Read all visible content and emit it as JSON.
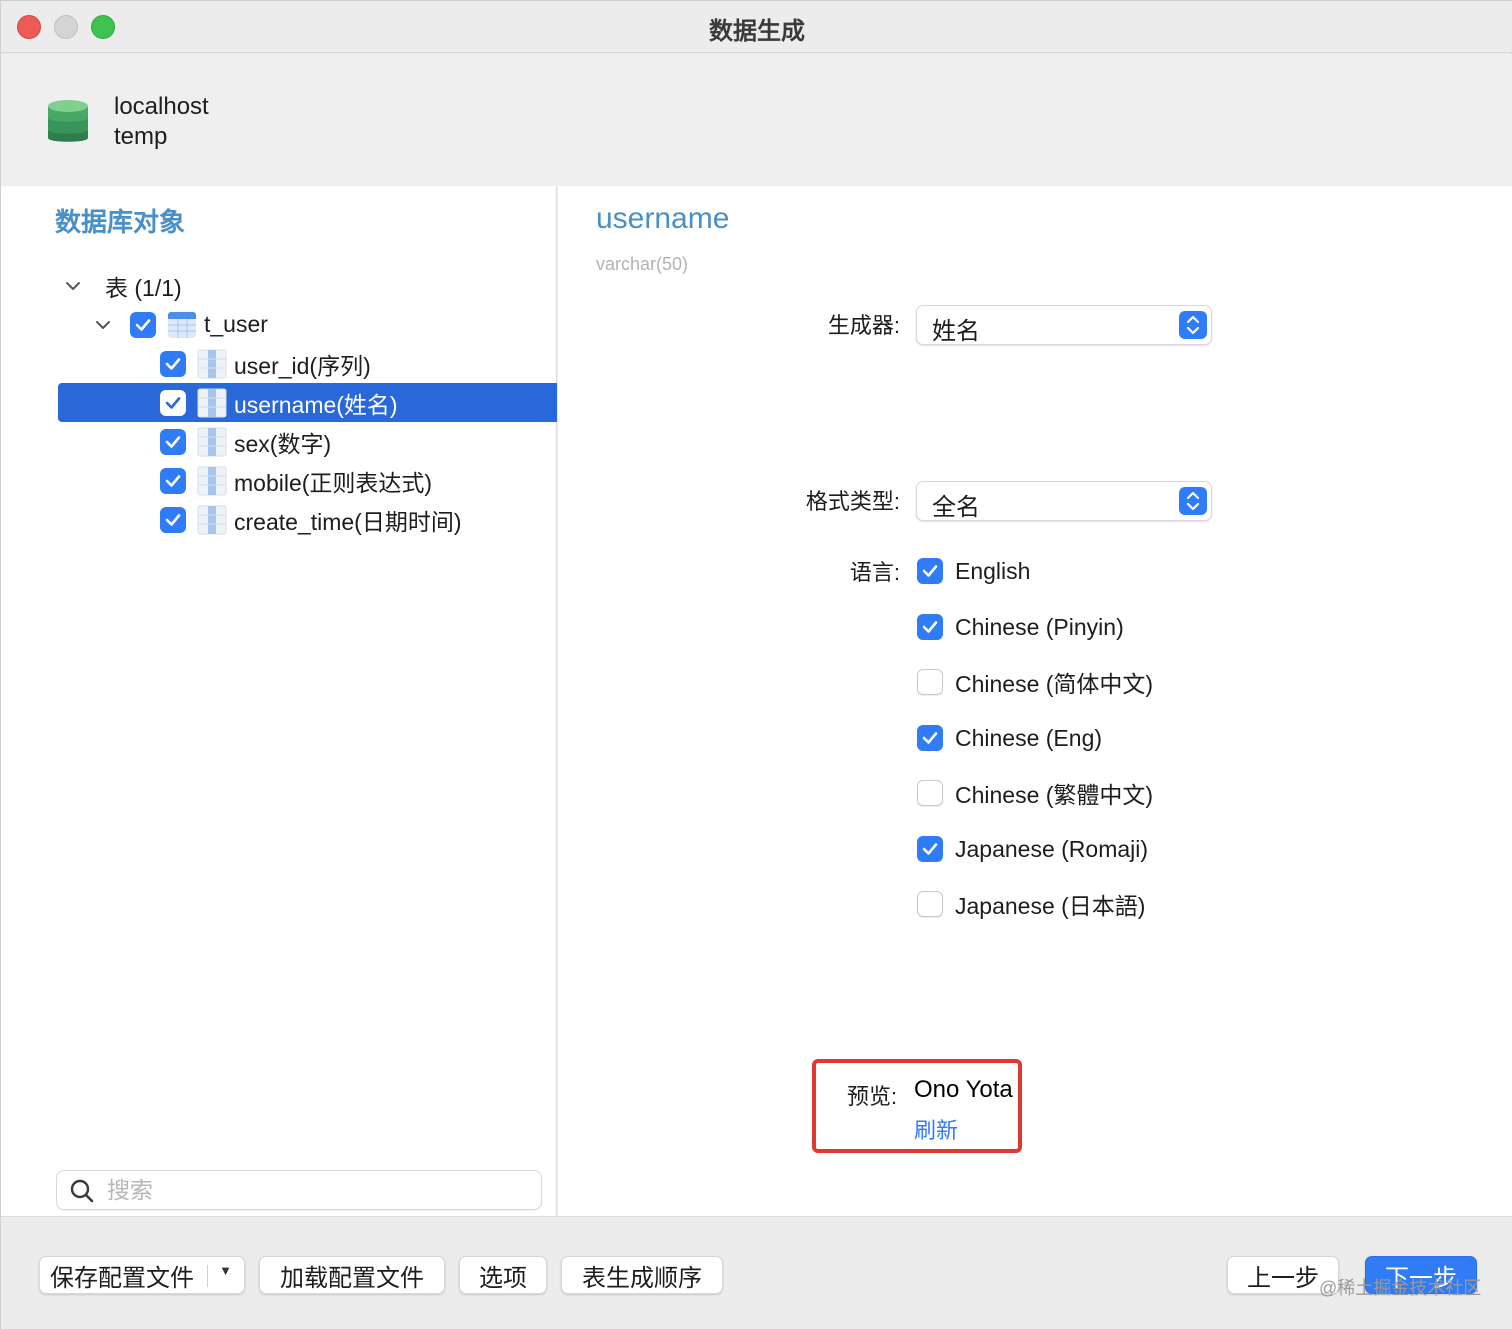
{
  "window": {
    "title": "数据生成"
  },
  "connection": {
    "name": "localhost",
    "database": "temp"
  },
  "left_panel": {
    "section_title": "数据库对象",
    "tree": {
      "group_label": "表 (1/1)",
      "table": {
        "label": "t_user",
        "checked": true
      },
      "columns": [
        {
          "label": "user_id(序列)",
          "checked": true,
          "selected": false
        },
        {
          "label": "username(姓名)",
          "checked": true,
          "selected": true
        },
        {
          "label": "sex(数字)",
          "checked": true,
          "selected": false
        },
        {
          "label": "mobile(正则表达式)",
          "checked": true,
          "selected": false
        },
        {
          "label": "create_time(日期时间)",
          "checked": true,
          "selected": false
        }
      ]
    },
    "search": {
      "placeholder": "搜索",
      "value": ""
    }
  },
  "detail": {
    "field_name": "username",
    "field_type": "varchar(50)",
    "generator": {
      "label": "生成器:",
      "value": "姓名"
    },
    "format_type": {
      "label": "格式类型:",
      "value": "全名"
    },
    "language": {
      "label": "语言:",
      "options": [
        {
          "label": "English",
          "checked": true
        },
        {
          "label": "Chinese (Pinyin)",
          "checked": true
        },
        {
          "label": "Chinese (简体中文)",
          "checked": false
        },
        {
          "label": "Chinese (Eng)",
          "checked": true
        },
        {
          "label": "Chinese (繁體中文)",
          "checked": false
        },
        {
          "label": "Japanese (Romaji)",
          "checked": true
        },
        {
          "label": "Japanese (日本語)",
          "checked": false
        }
      ]
    },
    "preview": {
      "label": "预览:",
      "value": "Ono Yota",
      "refresh_label": "刷新"
    }
  },
  "footer": {
    "save_config_label": "保存配置文件",
    "load_config_label": "加载配置文件",
    "options_label": "选项",
    "table_order_label": "表生成顺序",
    "prev_label": "上一步",
    "next_label": "下一步",
    "watermark": "@稀土掘金技术社区"
  },
  "colors": {
    "accent": "#2f7cf6",
    "selection": "#2868d8",
    "section_title": "#4a90c8",
    "highlight_box": "#e0392e"
  }
}
